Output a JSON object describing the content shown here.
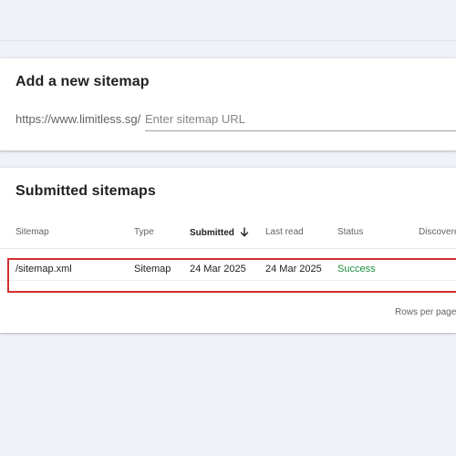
{
  "add_sitemap": {
    "title": "Add a new sitemap",
    "url_prefix": "https://www.limitless.sg/",
    "input_placeholder": "Enter sitemap URL",
    "input_value": ""
  },
  "submitted": {
    "title": "Submitted sitemaps",
    "columns": {
      "sitemap": "Sitemap",
      "type": "Type",
      "submitted": "Submitted",
      "last_read": "Last read",
      "status": "Status",
      "discovered": "Discovere"
    },
    "sort_icon": "arrow-down-icon",
    "rows": [
      {
        "sitemap": "/sitemap.xml",
        "type": "Sitemap",
        "submitted": "24 Mar 2025",
        "last_read": "24 Mar 2025",
        "status": "Success"
      }
    ],
    "pagination": {
      "rows_per_page_label": "Rows per page"
    }
  },
  "colors": {
    "background": "#f0f2f7",
    "card": "#ffffff",
    "success": "#1e8e3e",
    "highlight": "#d32f2f"
  }
}
